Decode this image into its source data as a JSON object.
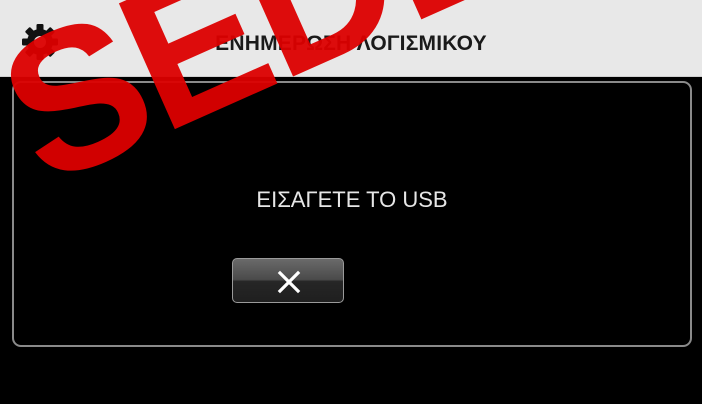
{
  "header": {
    "title": "ΕΝΗΜΕΡΩΣΗ ΛΟΓΙΣΜΙΚΟΥ",
    "icon": "gear-icon"
  },
  "dialog": {
    "message": "ΕΙΣΑΓΕΤΕ ΤΟ USB",
    "close_icon": "close-icon"
  },
  "watermark": {
    "text": "SEDE"
  },
  "colors": {
    "header_bg": "#e8e8e8",
    "screen_bg": "#000000",
    "watermark": "#dc0000"
  }
}
